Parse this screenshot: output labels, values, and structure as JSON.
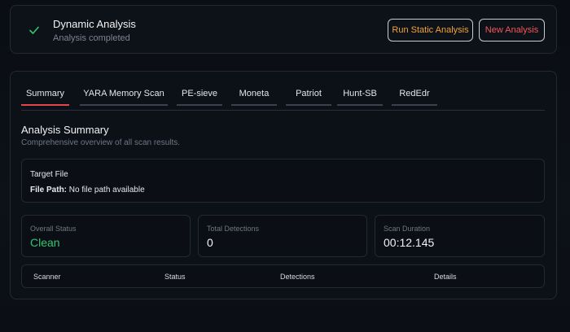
{
  "header": {
    "title": "Dynamic Analysis",
    "subtitle": "Analysis completed",
    "status_icon": "check-icon",
    "run_static_label": "Run Static Analysis",
    "new_analysis_label": "New Analysis"
  },
  "tabs": [
    {
      "label": "Summary",
      "active": true
    },
    {
      "label": "YARA Memory Scan",
      "active": false
    },
    {
      "label": "PE-sieve",
      "active": false
    },
    {
      "label": "Moneta",
      "active": false
    },
    {
      "label": "Patriot",
      "active": false
    },
    {
      "label": "Hunt-SB",
      "active": false
    },
    {
      "label": "RedEdr",
      "active": false
    }
  ],
  "summary": {
    "title": "Analysis Summary",
    "subtitle": "Comprehensive overview of all scan results.",
    "target": {
      "title": "Target File",
      "path_label": "File Path:",
      "path_value": "No file path available"
    },
    "stats": [
      {
        "label": "Overall Status",
        "value": "Clean"
      },
      {
        "label": "Total Detections",
        "value": "0"
      },
      {
        "label": "Scan Duration",
        "value": "00:12.145"
      }
    ],
    "table_headers": [
      "Scanner",
      "Status",
      "Detections",
      "Details"
    ]
  },
  "colors": {
    "accent_red": "#e0464b",
    "static_button_text": "#f0a43a",
    "new_button_text": "#f0585a",
    "clean_status": "#34c472",
    "check_icon": "#34c472"
  }
}
